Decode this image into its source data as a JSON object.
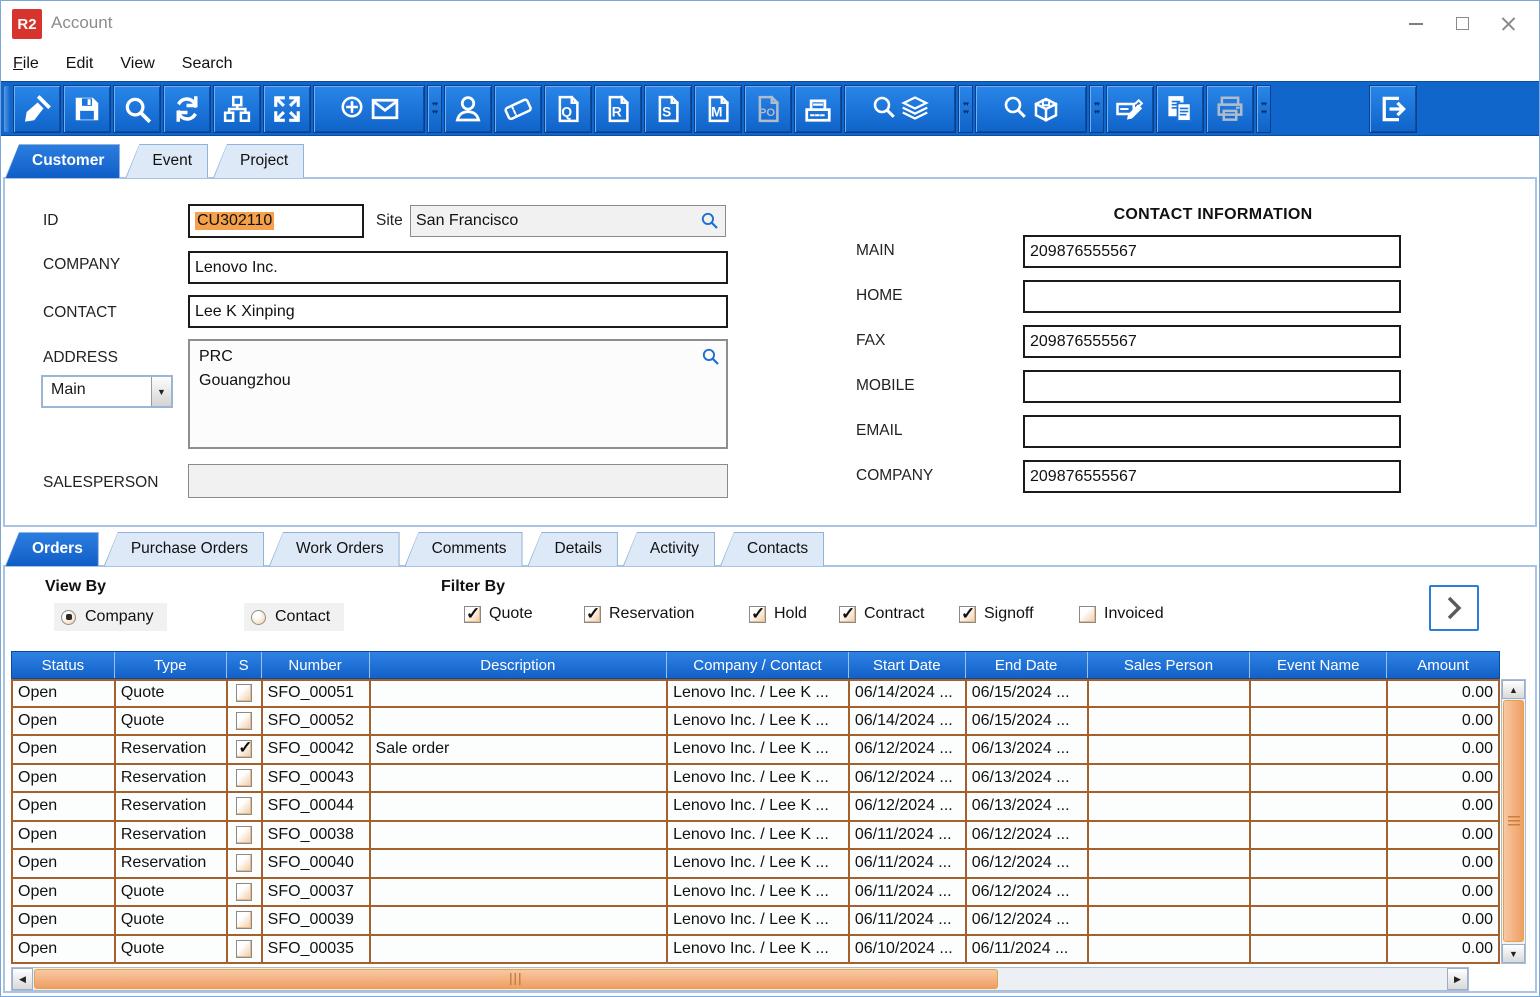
{
  "window": {
    "logo_text": "R2",
    "title": "Account",
    "controls": [
      "minimize",
      "maximize",
      "close"
    ]
  },
  "menu": {
    "items": [
      {
        "label": "File",
        "accel": true
      },
      {
        "label": "Edit"
      },
      {
        "label": "View"
      },
      {
        "label": "Search"
      }
    ]
  },
  "toolbar": {
    "items": [
      {
        "icon": "sweep-icon"
      },
      {
        "icon": "save-icon"
      },
      {
        "icon": "search-icon"
      },
      {
        "icon": "refresh-icon"
      },
      {
        "icon": "org-chart-icon"
      },
      {
        "icon": "expand-icon"
      },
      {
        "icon": "new-mail-icon",
        "wide": true
      },
      {
        "sep": true
      },
      {
        "icon": "person-icon"
      },
      {
        "icon": "ticket-icon"
      },
      {
        "icon": "doc-q-icon"
      },
      {
        "icon": "doc-r-icon"
      },
      {
        "icon": "doc-s-icon"
      },
      {
        "icon": "doc-m-icon"
      },
      {
        "icon": "doc-po-icon",
        "disabled": true
      },
      {
        "icon": "register-icon"
      },
      {
        "icon": "search-layers-icon",
        "wide": true
      },
      {
        "sep": true
      },
      {
        "icon": "search-box-icon",
        "wide": true
      },
      {
        "sep": true
      },
      {
        "icon": "edit-record-icon"
      },
      {
        "icon": "copy-icon"
      },
      {
        "icon": "print-icon",
        "disabled": true
      },
      {
        "sep": true
      },
      {
        "gap": true
      },
      {
        "icon": "exit-icon"
      }
    ]
  },
  "tabs_top": {
    "items": [
      {
        "label": "Customer",
        "active": true
      },
      {
        "label": "Event"
      },
      {
        "label": "Project"
      }
    ]
  },
  "form": {
    "id_label": "ID",
    "id_value": "CU302110",
    "site_label": "Site",
    "site_value": "San Francisco",
    "company_label": "COMPANY",
    "company_value": "Lenovo Inc.",
    "contact_label": "CONTACT",
    "contact_value": "Lee K Xinping",
    "address_label": "ADDRESS",
    "address_type_value": "Main",
    "address_lines": [
      "PRC",
      "Gouangzhou"
    ],
    "salesperson_label": "SALESPERSON",
    "salesperson_value": ""
  },
  "contact_info": {
    "title": "CONTACT INFORMATION",
    "fields": [
      {
        "label": "MAIN",
        "value": "209876555567"
      },
      {
        "label": "HOME",
        "value": ""
      },
      {
        "label": "FAX",
        "value": "209876555567"
      },
      {
        "label": "MOBILE",
        "value": ""
      },
      {
        "label": "EMAIL",
        "value": ""
      },
      {
        "label": "COMPANY",
        "value": "209876555567"
      }
    ]
  },
  "tabs_bottom": {
    "items": [
      {
        "label": "Orders",
        "active": true
      },
      {
        "label": "Purchase Orders"
      },
      {
        "label": "Work Orders"
      },
      {
        "label": "Comments"
      },
      {
        "label": "Details"
      },
      {
        "label": "Activity"
      },
      {
        "label": "Contacts"
      }
    ]
  },
  "view_by": {
    "label": "View By",
    "options": [
      {
        "label": "Company",
        "selected": true
      },
      {
        "label": "Contact",
        "selected": false
      }
    ]
  },
  "filter_by": {
    "label": "Filter By",
    "options": [
      {
        "label": "Quote",
        "checked": true
      },
      {
        "label": "Reservation",
        "checked": true
      },
      {
        "label": "Hold",
        "checked": true
      },
      {
        "label": "Contract",
        "checked": true
      },
      {
        "label": "Signoff",
        "checked": true
      },
      {
        "label": "Invoiced",
        "checked": false
      }
    ]
  },
  "orders_nav": {
    "next_icon": "chevron-right-icon"
  },
  "table": {
    "columns": [
      {
        "key": "status",
        "label": "Status"
      },
      {
        "key": "type",
        "label": "Type"
      },
      {
        "key": "s",
        "label": "S"
      },
      {
        "key": "number",
        "label": "Number"
      },
      {
        "key": "description",
        "label": "Description"
      },
      {
        "key": "company_contact",
        "label": "Company / Contact"
      },
      {
        "key": "start_date",
        "label": "Start Date"
      },
      {
        "key": "end_date",
        "label": "End Date"
      },
      {
        "key": "sales_person",
        "label": "Sales Person"
      },
      {
        "key": "event_name",
        "label": "Event Name"
      },
      {
        "key": "amount",
        "label": "Amount"
      }
    ],
    "rows": [
      {
        "status": "Open",
        "type": "Quote",
        "s": false,
        "number": "SFO_00051",
        "description": "",
        "company_contact": "Lenovo Inc. / Lee K ...",
        "start_date": "06/14/2024 ...",
        "end_date": "06/15/2024 ...",
        "sales_person": "",
        "event_name": "",
        "amount": "0.00"
      },
      {
        "status": "Open",
        "type": "Quote",
        "s": false,
        "number": "SFO_00052",
        "description": "",
        "company_contact": "Lenovo Inc. / Lee K ...",
        "start_date": "06/14/2024 ...",
        "end_date": "06/15/2024 ...",
        "sales_person": "",
        "event_name": "",
        "amount": "0.00"
      },
      {
        "status": "Open",
        "type": "Reservation",
        "s": true,
        "number": "SFO_00042",
        "description": "Sale order",
        "company_contact": "Lenovo Inc. / Lee K ...",
        "start_date": "06/12/2024 ...",
        "end_date": "06/13/2024 ...",
        "sales_person": "",
        "event_name": "",
        "amount": "0.00"
      },
      {
        "status": "Open",
        "type": "Reservation",
        "s": false,
        "number": "SFO_00043",
        "description": "",
        "company_contact": "Lenovo Inc. / Lee K ...",
        "start_date": "06/12/2024 ...",
        "end_date": "06/13/2024 ...",
        "sales_person": "",
        "event_name": "",
        "amount": "0.00"
      },
      {
        "status": "Open",
        "type": "Reservation",
        "s": false,
        "number": "SFO_00044",
        "description": "",
        "company_contact": "Lenovo Inc. / Lee K ...",
        "start_date": "06/12/2024 ...",
        "end_date": "06/13/2024 ...",
        "sales_person": "",
        "event_name": "",
        "amount": "0.00"
      },
      {
        "status": "Open",
        "type": "Reservation",
        "s": false,
        "number": "SFO_00038",
        "description": "",
        "company_contact": "Lenovo Inc. / Lee K ...",
        "start_date": "06/11/2024 ...",
        "end_date": "06/12/2024 ...",
        "sales_person": "",
        "event_name": "",
        "amount": "0.00"
      },
      {
        "status": "Open",
        "type": "Reservation",
        "s": false,
        "number": "SFO_00040",
        "description": "",
        "company_contact": "Lenovo Inc. / Lee K ...",
        "start_date": "06/11/2024 ...",
        "end_date": "06/12/2024 ...",
        "sales_person": "",
        "event_name": "",
        "amount": "0.00"
      },
      {
        "status": "Open",
        "type": "Quote",
        "s": false,
        "number": "SFO_00037",
        "description": "",
        "company_contact": "Lenovo Inc. / Lee K ...",
        "start_date": "06/11/2024 ...",
        "end_date": "06/12/2024 ...",
        "sales_person": "",
        "event_name": "",
        "amount": "0.00"
      },
      {
        "status": "Open",
        "type": "Quote",
        "s": false,
        "number": "SFO_00039",
        "description": "",
        "company_contact": "Lenovo Inc. / Lee K ...",
        "start_date": "06/11/2024 ...",
        "end_date": "06/12/2024 ...",
        "sales_person": "",
        "event_name": "",
        "amount": "0.00"
      },
      {
        "status": "Open",
        "type": "Quote",
        "s": false,
        "number": "SFO_00035",
        "description": "",
        "company_contact": "Lenovo Inc. / Lee K ...",
        "start_date": "06/10/2024 ...",
        "end_date": "06/11/2024 ...",
        "sales_person": "",
        "event_name": "",
        "amount": "0.00"
      }
    ]
  }
}
